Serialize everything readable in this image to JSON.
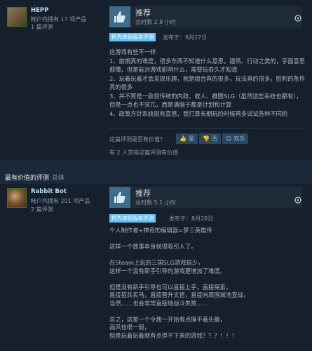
{
  "review1": {
    "author": "HEPP",
    "products": "帐户内拥有 17 项产品",
    "reviews": "1 篇评测",
    "recommendation": "推荐",
    "hours": "总时数 2.8 小时",
    "early_access": "抢先体验版本评测",
    "posted": "发布于：8月27日",
    "body": [
      "这游戏有些不一样",
      "1、前期真的难度，很多东西不知道什么意思，建筑、行动之类的，字面意思都懂，但是能对游戏影响什么，需要玩很久才知道",
      "2、玩着玩着才会发现乐趣，就是组合真的很多，玩法真的很多，胜利的条件真的很多",
      "3、并不算是一款很传统的内政、收人、推图SLG（虽然这些系统也都有），但是一点也不突兀，而是满脑子都是计划和计算",
      "4、政策方针系统挺有意思，我打算长期玩的时候再多试试各种不同的"
    ],
    "helpful_question": "这篇评测是否有价值？",
    "btn_yes": "是",
    "btn_no": "否",
    "btn_funny": "欢乐",
    "helpful_count": "有 2 人觉得这篇评测有价值"
  },
  "section": {
    "title": "最有价值的评测",
    "subtitle": "总体"
  },
  "review2": {
    "author": "Rabbit Bot",
    "products": "帐户内拥有 201 项产品",
    "reviews": "2 篇评测",
    "recommendation": "推荐",
    "hours": "总时数 5.1 小时",
    "early_access": "抢先体验版本评测",
    "posted": "发布于：8月28日",
    "body": [
      "个人制作者+神奇的编辑器=梦三英雄传",
      "",
      "这样一个故事本身就很吸引人了。",
      "",
      "在Steam上玩的三国SLG游戏很少，",
      "这样一个没有新手引导的游戏更增加了难度。",
      "",
      "但是没有新手引导也可以直接上手，直接探索，",
      "直接招兵买马，直接晋升文官，直接向周围城池宣战，",
      "当然……也会非常直接地战斗失败……",
      "",
      "总之，这是一个令我一开始有点摸不着头脑，",
      "画风也很一般，",
      "但是玩着玩着就有点停不下来的游戏？？？！！！"
    ]
  },
  "colors": {
    "background": "#1b2838",
    "review_bg": "#16202d",
    "thumb_bg": "#3d6c8d",
    "accent_blue": "#66c0f4",
    "muted_text": "#8f98a0"
  },
  "icons": {
    "thumb": "thumbs-up-icon",
    "more": "more-options-icon"
  }
}
